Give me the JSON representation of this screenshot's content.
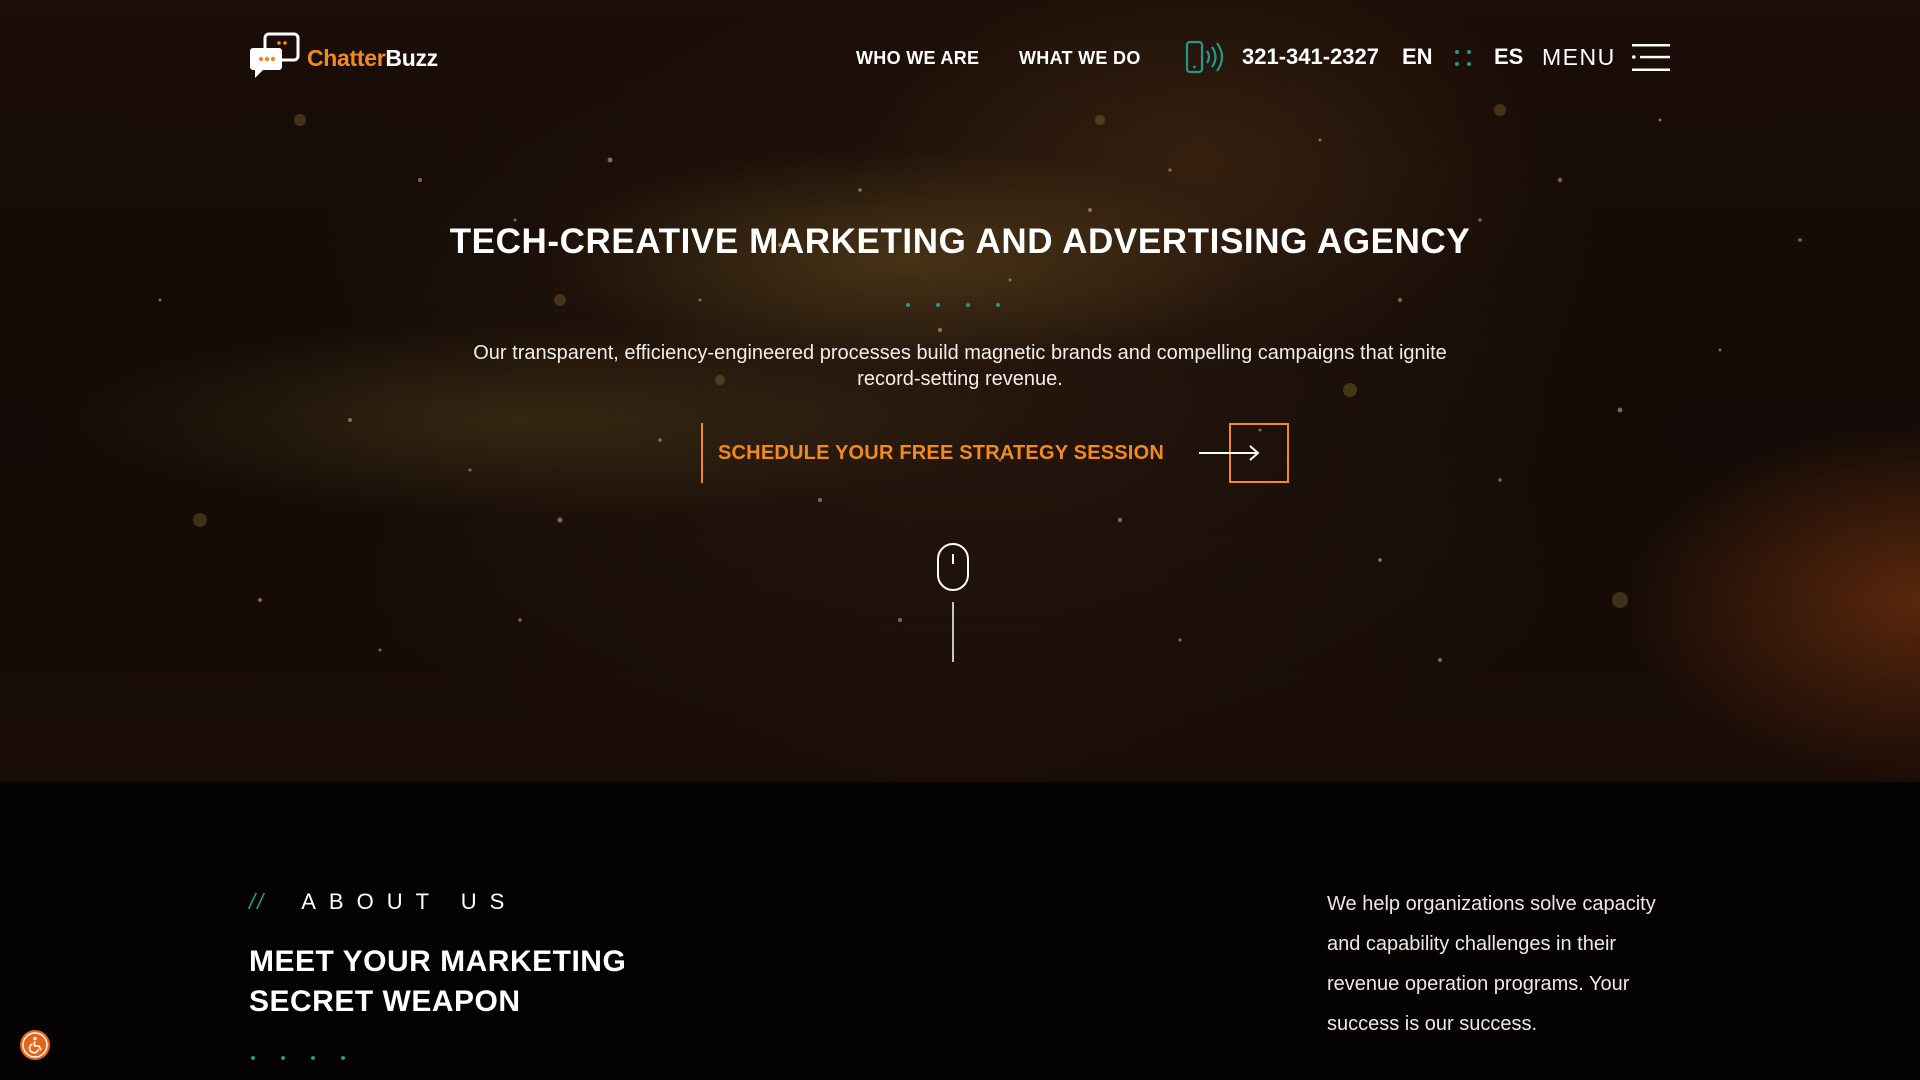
{
  "brand": {
    "name_part1": "Chatter",
    "name_part2": "Buzz"
  },
  "nav": {
    "items": [
      {
        "label": "WHO WE ARE"
      },
      {
        "label": "WHAT WE DO"
      }
    ],
    "phone": "321-341-2327",
    "lang_en": "EN",
    "lang_es": "ES",
    "menu_label": "MENU"
  },
  "hero": {
    "title": "TECH-CREATIVE MARKETING AND ADVERTISING AGENCY",
    "subtitle": "Our transparent, efficiency-engineered processes build magnetic brands and compelling campaigns that ignite record-setting revenue.",
    "cta_label": "SCHEDULE YOUR FREE STRATEGY SESSION"
  },
  "about": {
    "eyebrow_mark": "//",
    "eyebrow": "ABOUT US",
    "title": "MEET YOUR MARKETING SECRET WEAPON",
    "copy": "We help organizations solve capacity and capability challenges in their revenue operation programs. Your success is our success."
  },
  "colors": {
    "accent": "#f28a1e",
    "teal": "#1f9a8e",
    "background": "#050302"
  },
  "icons": {
    "phone": "phone-ringing-icon",
    "menu": "hamburger-menu-icon",
    "scroll": "mouse-scroll-icon",
    "cta": "arrow-right-icon",
    "accessibility": "wheelchair-icon"
  }
}
